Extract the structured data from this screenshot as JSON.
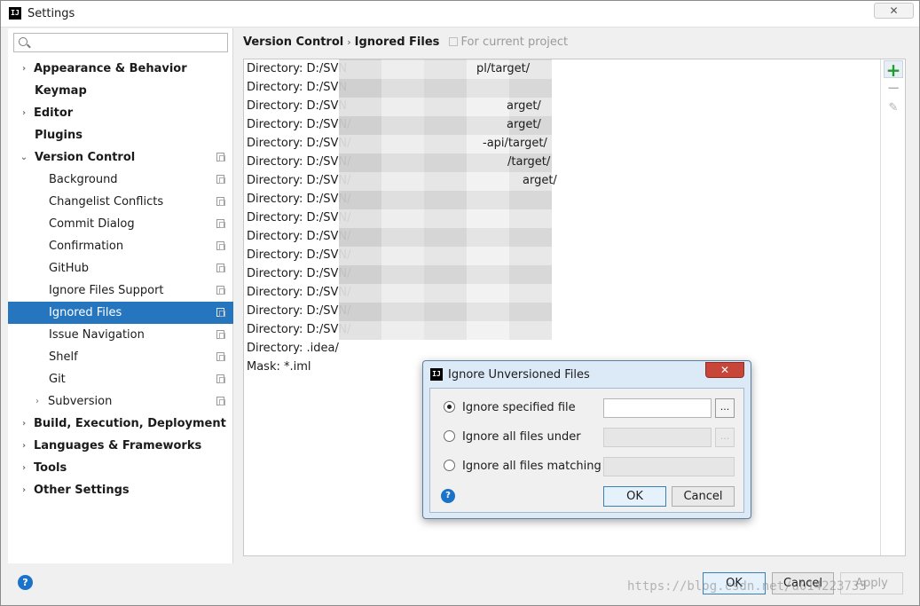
{
  "window": {
    "title": "Settings",
    "close_glyph": "✕"
  },
  "search": {
    "value": "",
    "placeholder": ""
  },
  "sidebar": {
    "items": [
      {
        "label": "Appearance & Behavior",
        "arrow": "›"
      },
      {
        "label": "Keymap"
      },
      {
        "label": "Editor",
        "arrow": "›"
      },
      {
        "label": "Plugins"
      },
      {
        "label": "Version Control",
        "arrow": "⌄"
      },
      {
        "label": "Background"
      },
      {
        "label": "Changelist Conflicts"
      },
      {
        "label": "Commit Dialog"
      },
      {
        "label": "Confirmation"
      },
      {
        "label": "GitHub"
      },
      {
        "label": "Ignore Files Support"
      },
      {
        "label": "Ignored Files"
      },
      {
        "label": "Issue Navigation"
      },
      {
        "label": "Shelf"
      },
      {
        "label": "Git"
      },
      {
        "label": "Subversion",
        "arrow": "›"
      },
      {
        "label": "Build, Execution, Deployment",
        "arrow": "›"
      },
      {
        "label": "Languages & Frameworks",
        "arrow": "›"
      },
      {
        "label": "Tools",
        "arrow": "›"
      },
      {
        "label": "Other Settings",
        "arrow": "›"
      }
    ]
  },
  "breadcrumb": {
    "parent": "Version Control",
    "separator": "›",
    "current": "Ignored Files",
    "scope": "For current project"
  },
  "ignored_list": [
    "Directory: D:/SVN",
    "Directory: D:/SVN",
    "Directory: D:/SVN",
    "Directory: D:/SVN/",
    "Directory: D:/SVN/",
    "Directory: D:/SVN/",
    "Directory: D:/SVN/",
    "Directory: D:/SVN/",
    "Directory: D:/SVN/",
    "Directory: D:/SVN/",
    "Directory: D:/SVN/",
    "Directory: D:/SVN/",
    "Directory: D:/SVN/",
    "Directory: D:/SVN/",
    "Directory: D:/SVN/",
    "Directory: .idea/",
    "Mask: *.iml"
  ],
  "list_fragments": [
    "pl/target/",
    "arget/",
    "arget/",
    "-api/target/",
    "/target/",
    "arget/"
  ],
  "list_toolbar": {
    "add": "+",
    "remove": "−",
    "edit": "✎"
  },
  "footer": {
    "help": "?",
    "ok": "OK",
    "cancel": "Cancel",
    "apply": "Apply",
    "watermark": "https://blog.csdn.net/u014223733"
  },
  "dialog": {
    "title": "Ignore Unversioned Files",
    "close_glyph": "✕",
    "options": [
      {
        "label": "Ignore specified file",
        "checked": true
      },
      {
        "label": "Ignore all files under",
        "checked": false
      },
      {
        "label": "Ignore all files matching",
        "checked": false
      }
    ],
    "browse": "...",
    "help": "?",
    "ok": "OK",
    "cancel": "Cancel"
  }
}
